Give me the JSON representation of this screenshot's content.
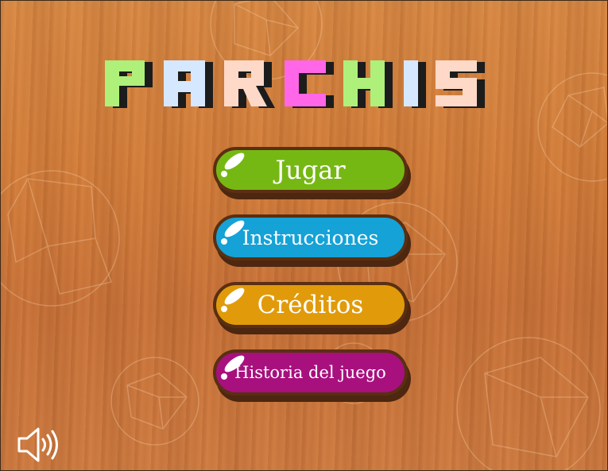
{
  "title": {
    "letters": [
      "P",
      "A",
      "R",
      "C",
      "H",
      "I",
      "S"
    ],
    "colors": [
      "#aef07a",
      "#d6e8ff",
      "#ffd9c8",
      "#ff66e8",
      "#aef07a",
      "#d6e8ff",
      "#ffd9c8"
    ]
  },
  "menu": {
    "play_label": "Jugar",
    "instructions_label": "Instrucciones",
    "credits_label": "Créditos",
    "history_label": "Historia del juego"
  },
  "colors": {
    "play": "#76b813",
    "instructions": "#15a2d6",
    "credits": "#e19b0a",
    "history": "#a8107e",
    "button_border": "#5a2f12",
    "wood": "#d47f3c"
  },
  "icons": {
    "sound": "speaker-on-icon"
  }
}
